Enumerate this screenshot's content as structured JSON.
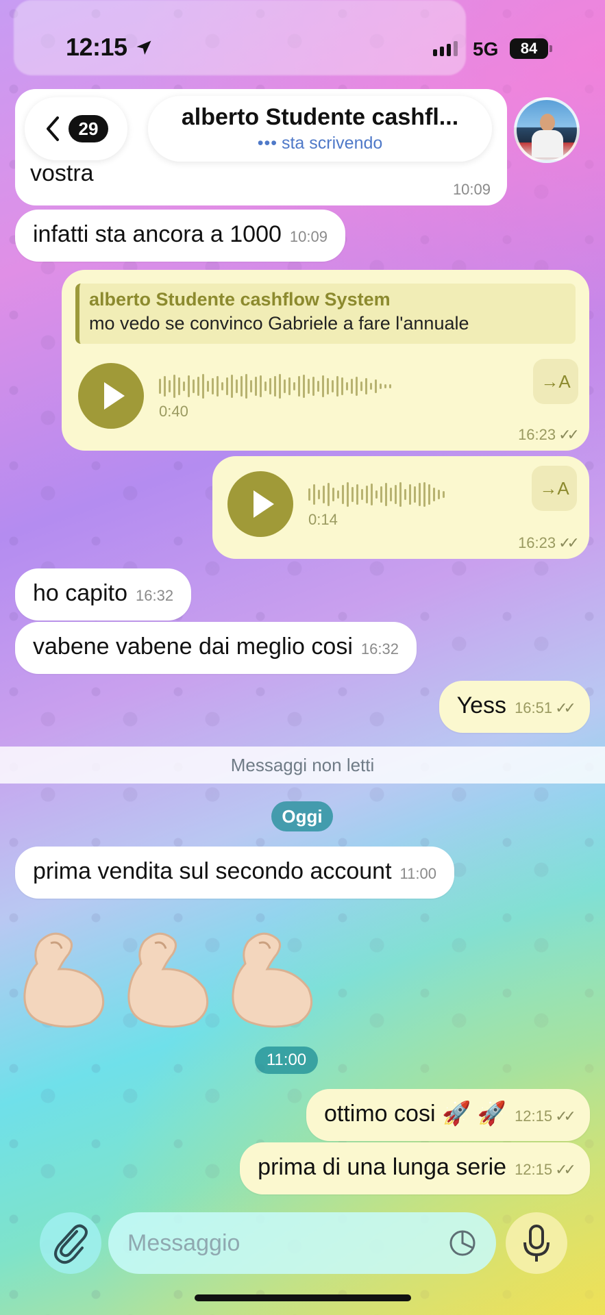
{
  "status_bar": {
    "time": "12:15",
    "network": "5G",
    "battery": "84"
  },
  "header": {
    "back_count": "29",
    "chat_title": "alberto Studente cashfl...",
    "typing_dots": "•••",
    "status": "sta scrivendo"
  },
  "messages": {
    "partial": {
      "text": "vostra",
      "time": "10:09"
    },
    "m1": {
      "text": "infatti sta ancora a 1000",
      "time": "10:09"
    },
    "voice1": {
      "reply_name": "alberto Studente cashflow System",
      "reply_text": "mo vedo se convinco Gabriele a fare l'annuale",
      "duration": "0:40",
      "time": "16:23",
      "transcribe": "→A"
    },
    "voice2": {
      "duration": "0:14",
      "time": "16:23",
      "transcribe": "→A"
    },
    "m2": {
      "text": "ho capito",
      "time": "16:32"
    },
    "m3": {
      "text": "vabene vabene dai meglio cosi",
      "time": "16:32"
    },
    "m4": {
      "text": "Yess",
      "time": "16:51"
    },
    "unread_label": "Messaggi non letti",
    "date_chip": "Oggi",
    "m5": {
      "text": "prima vendita sul secondo account",
      "time": "11:00"
    },
    "emoji_time": "11:00",
    "m6": {
      "text": "ottimo cosi 🚀 🚀",
      "time": "12:15"
    },
    "m7": {
      "text": "prima di una lunga serie",
      "time": "12:15"
    }
  },
  "input": {
    "placeholder": "Messaggio"
  },
  "colors": {
    "outgoing_bubble": "#fbf8cf",
    "incoming_bubble": "#ffffff",
    "accent_voice": "#a09a38",
    "typing_status": "#4f79c8"
  },
  "icons": [
    "location-arrow-icon",
    "signal-icon",
    "chevron-left-icon",
    "play-icon",
    "transcribe-icon",
    "checkmarks-icon",
    "paperclip-icon",
    "sticker-icon",
    "microphone-icon"
  ]
}
